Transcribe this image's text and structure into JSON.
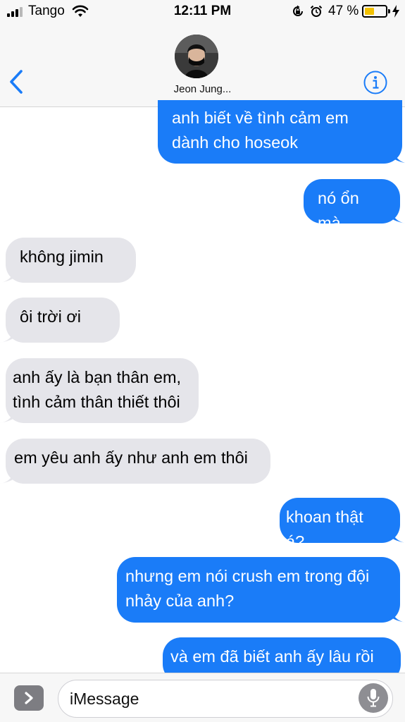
{
  "status_bar": {
    "carrier": "Tango",
    "time": "12:11 PM",
    "battery_percent": "47 %",
    "battery_level": 0.47
  },
  "header": {
    "contact_name": "Jeon Jung..."
  },
  "messages": [
    {
      "direction": "outgoing",
      "lines": [
        "anh biết về tình cảm em",
        "dành cho hoseok"
      ]
    },
    {
      "direction": "outgoing",
      "lines": [
        "nó ổn mà"
      ]
    },
    {
      "direction": "incoming",
      "lines": [
        "không jimin"
      ]
    },
    {
      "direction": "incoming",
      "lines": [
        "ôi trời ơi"
      ]
    },
    {
      "direction": "incoming",
      "lines": [
        "anh ấy là bạn thân em,",
        "tình cảm thân thiết thôi"
      ]
    },
    {
      "direction": "incoming",
      "lines": [
        "em yêu anh ấy như anh em thôi"
      ]
    },
    {
      "direction": "outgoing",
      "lines": [
        "khoan thật á?"
      ]
    },
    {
      "direction": "outgoing",
      "lines": [
        "nhưng em nói crush em trong đội",
        "nhảy của anh?"
      ]
    },
    {
      "direction": "outgoing",
      "lines": [
        "và em đã biết anh ấy lâu rồi"
      ]
    }
  ],
  "input": {
    "placeholder": "iMessage"
  },
  "colors": {
    "outgoing_bubble": "#1a7cf8",
    "incoming_bubble": "#e5e5ea",
    "accent": "#1a7cf8",
    "battery_fill": "#f2c100"
  },
  "icons": [
    "signal-icon",
    "wifi-icon",
    "orientation-lock-icon",
    "alarm-icon",
    "battery-icon",
    "charging-bolt-icon",
    "back-chevron-icon",
    "info-icon",
    "app-drawer-icon",
    "microphone-icon"
  ]
}
